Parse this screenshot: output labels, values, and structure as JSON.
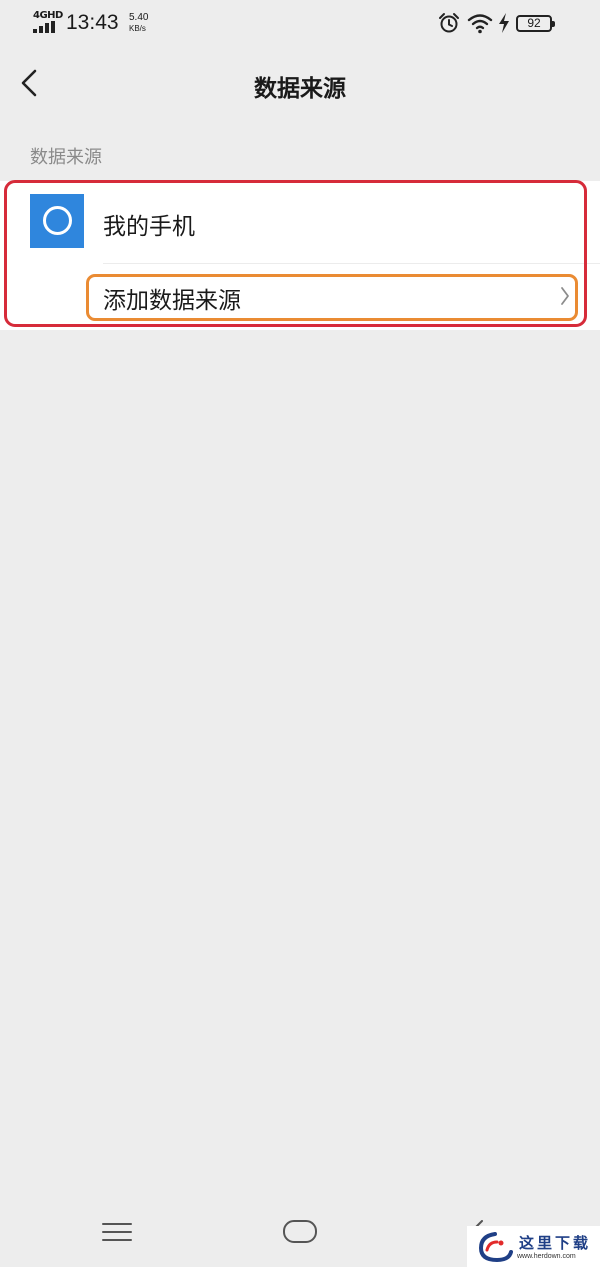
{
  "status_bar": {
    "network": "4GHD",
    "time": "13:43",
    "speed_value": "5.40",
    "speed_unit": "KB/s",
    "battery_level": "92",
    "icons": [
      "alarm-icon",
      "wifi-icon",
      "charging-icon"
    ]
  },
  "header": {
    "title": "数据来源",
    "back_icon": "chevron-left-icon"
  },
  "section": {
    "label": "数据来源"
  },
  "sources": {
    "items": [
      {
        "name": "我的手机",
        "icon": "phone-source-icon",
        "icon_color": "#2f86dd"
      }
    ],
    "add_label": "添加数据来源"
  },
  "annotations": {
    "outer_highlight_color": "#d62b3a",
    "inner_highlight_color": "#ea8b33"
  },
  "watermark": {
    "text": "这里下载",
    "url": "www.herdown.com"
  }
}
